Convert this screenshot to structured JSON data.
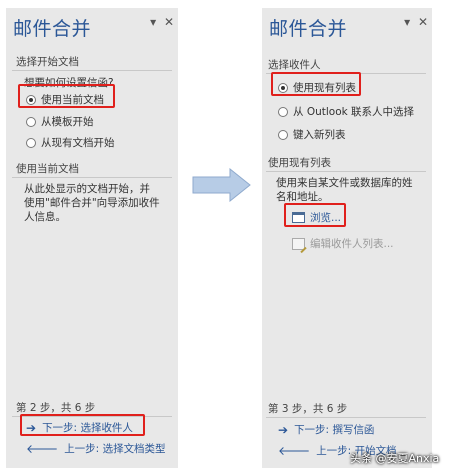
{
  "left_pane": {
    "title": "邮件合并",
    "controls": {
      "dropdown": "▾",
      "close": "✕"
    },
    "section1_heading": "选择开始文档",
    "prompt": "想要如何设置信函?",
    "options": [
      "使用当前文档",
      "从模板开始",
      "从现有文档开始"
    ],
    "selected_index": 0,
    "section2_heading": "使用当前文档",
    "description": "从此处显示的文档开始，并使用\"邮件合并\"向导添加收件人信息。",
    "step_text": "第 2 步，共 6 步",
    "next": "下一步: 选择收件人",
    "prev": "上一步: 选择文档类型"
  },
  "right_pane": {
    "title": "邮件合并",
    "controls": {
      "dropdown": "▾",
      "close": "✕"
    },
    "section1_heading": "选择收件人",
    "options": [
      "使用现有列表",
      "从 Outlook 联系人中选择",
      "键入新列表"
    ],
    "selected_index": 0,
    "section2_heading": "使用现有列表",
    "description": "使用来自某文件或数据库的姓名和地址。",
    "browse": "浏览...",
    "edit_list": "编辑收件人列表...",
    "step_text": "第 3 步，共 6 步",
    "next": "下一步: 撰写信函",
    "prev": "上一步: 开始文档"
  },
  "watermark": "头条 @安夏Anxia",
  "colors": {
    "pane_bg": "#e8e8e8",
    "title": "#2b5797",
    "highlight": "#e0201c",
    "arrow_fill": "#b7cce6"
  }
}
